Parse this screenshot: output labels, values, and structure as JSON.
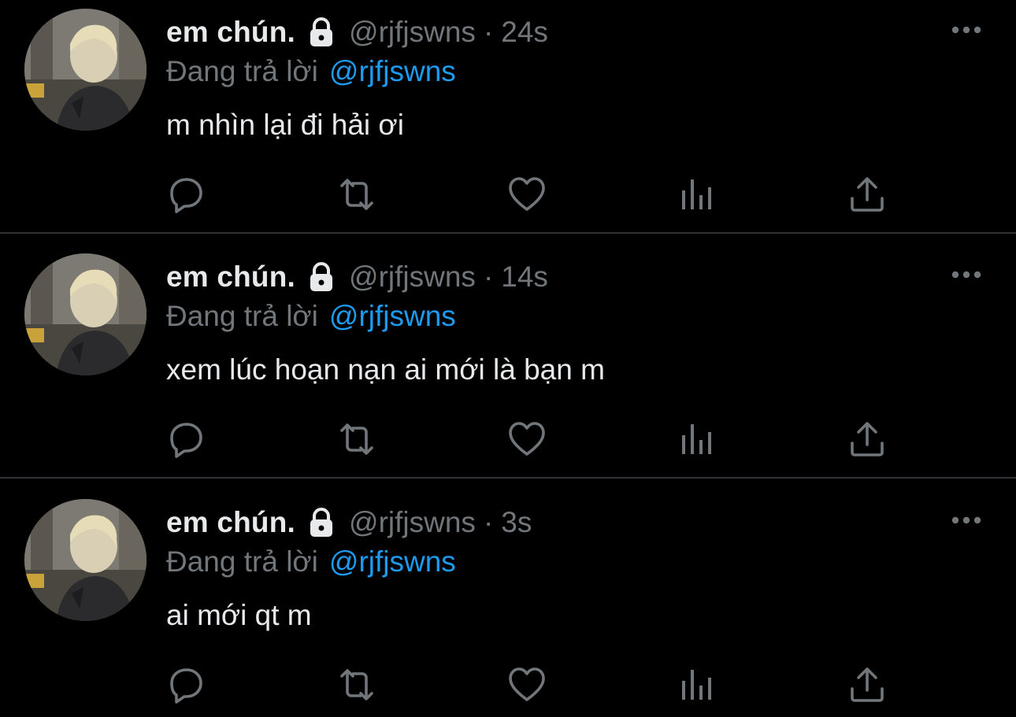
{
  "tweets": [
    {
      "display_name": "em chún.",
      "handle": "@rjfjswns",
      "separator": "·",
      "time": "24s",
      "reply_label": "Đang trả lời",
      "reply_mention": "@rjfjswns",
      "text": "m nhìn lại đi hải ơi"
    },
    {
      "display_name": "em chún.",
      "handle": "@rjfjswns",
      "separator": "·",
      "time": "14s",
      "reply_label": "Đang trả lời",
      "reply_mention": "@rjfjswns",
      "text": "xem lúc hoạn nạn ai mới là bạn m"
    },
    {
      "display_name": "em chún.",
      "handle": "@rjfjswns",
      "separator": "·",
      "time": "3s",
      "reply_label": "Đang trả lời",
      "reply_mention": "@rjfjswns",
      "text": "ai mới qt m"
    }
  ],
  "icons": {
    "lock": "lock-icon",
    "more": "more-icon",
    "reply": "reply-icon",
    "retweet": "retweet-icon",
    "like": "like-icon",
    "views": "views-icon",
    "share": "share-icon"
  },
  "colors": {
    "background": "#000000",
    "primary_text": "#e7e9ea",
    "secondary_text": "#71767b",
    "accent": "#1d9bf0",
    "divider": "#2f3336"
  }
}
